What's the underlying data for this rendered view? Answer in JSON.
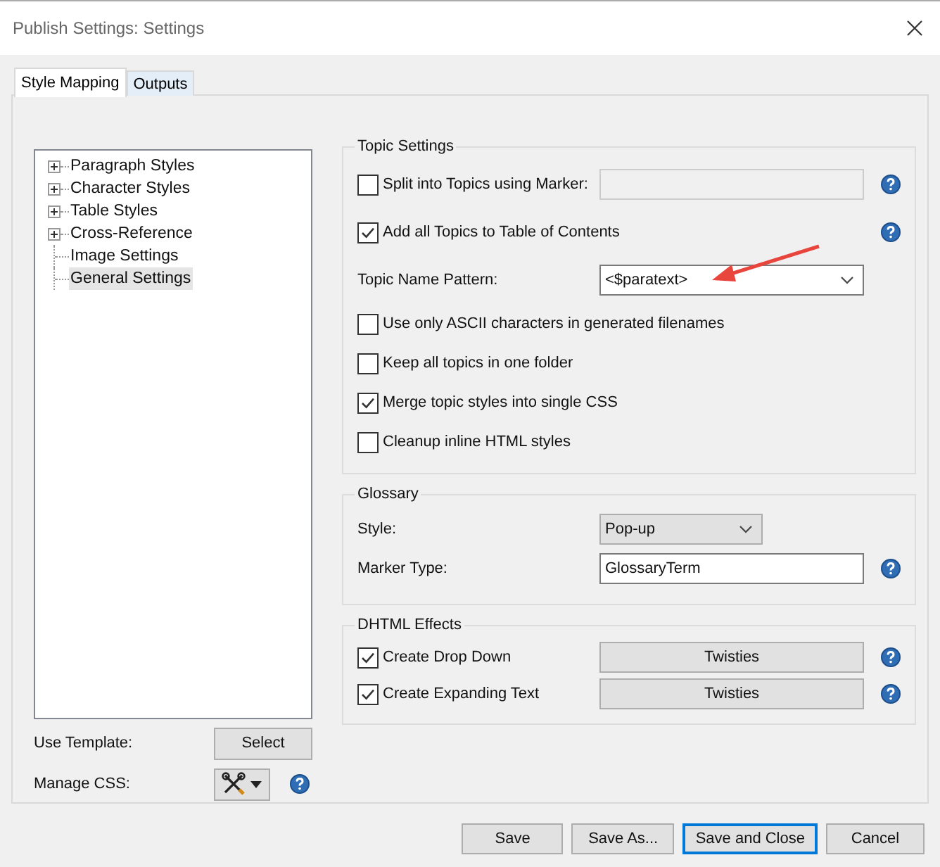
{
  "window": {
    "title": "Publish Settings: Settings"
  },
  "tabs": [
    {
      "label": "Style Mapping",
      "selected": true
    },
    {
      "label": "Outputs",
      "selected": false
    }
  ],
  "tree": [
    {
      "kind": "group",
      "label": "Paragraph Styles",
      "selected": false
    },
    {
      "kind": "group",
      "label": "Character Styles",
      "selected": false
    },
    {
      "kind": "group",
      "label": "Table Styles",
      "selected": false
    },
    {
      "kind": "group",
      "label": "Cross-Reference",
      "selected": false
    },
    {
      "kind": "leaf",
      "label": "Image Settings",
      "selected": false
    },
    {
      "kind": "leaf",
      "label": "General Settings",
      "selected": true
    }
  ],
  "template": {
    "label": "Use Template:",
    "button": "Select"
  },
  "manage_css": {
    "label": "Manage CSS:"
  },
  "topic_settings": {
    "title": "Topic Settings",
    "rows": [
      {
        "kind": "check-field",
        "label": "Split into Topics using Marker:",
        "checked": false,
        "help": true
      },
      {
        "kind": "check",
        "label": "Add all Topics to Table of Contents",
        "checked": true,
        "help": true
      },
      {
        "kind": "combo",
        "label": "Topic Name Pattern:",
        "value": "<$paratext>",
        "help": false
      },
      {
        "kind": "check",
        "label": "Use only ASCII characters in generated filenames",
        "checked": false,
        "help": false
      },
      {
        "kind": "check",
        "label": "Keep all topics in one folder",
        "checked": false,
        "help": false
      },
      {
        "kind": "check",
        "label": "Merge topic styles into single CSS",
        "checked": true,
        "help": false
      },
      {
        "kind": "check",
        "label": "Cleanup inline HTML styles",
        "checked": false,
        "help": false
      }
    ]
  },
  "glossary": {
    "title": "Glossary",
    "rows": [
      {
        "kind": "select",
        "label": "Style:",
        "value": "Pop-up",
        "help": false
      },
      {
        "kind": "text",
        "label": "Marker Type:",
        "value": "GlossaryTerm",
        "help": true
      }
    ]
  },
  "dhtml": {
    "title": "DHTML Effects",
    "rows": [
      {
        "kind": "check-button",
        "label": "Create Drop Down",
        "checked": true,
        "button": "Twisties",
        "help": true
      },
      {
        "kind": "check-button",
        "label": "Create Expanding Text",
        "checked": true,
        "button": "Twisties",
        "help": true
      }
    ]
  },
  "buttons": [
    {
      "label": "Save",
      "default": false
    },
    {
      "label": "Save As...",
      "default": false
    },
    {
      "label": "Save and Close",
      "default": true
    },
    {
      "label": "Cancel",
      "default": false
    }
  ]
}
